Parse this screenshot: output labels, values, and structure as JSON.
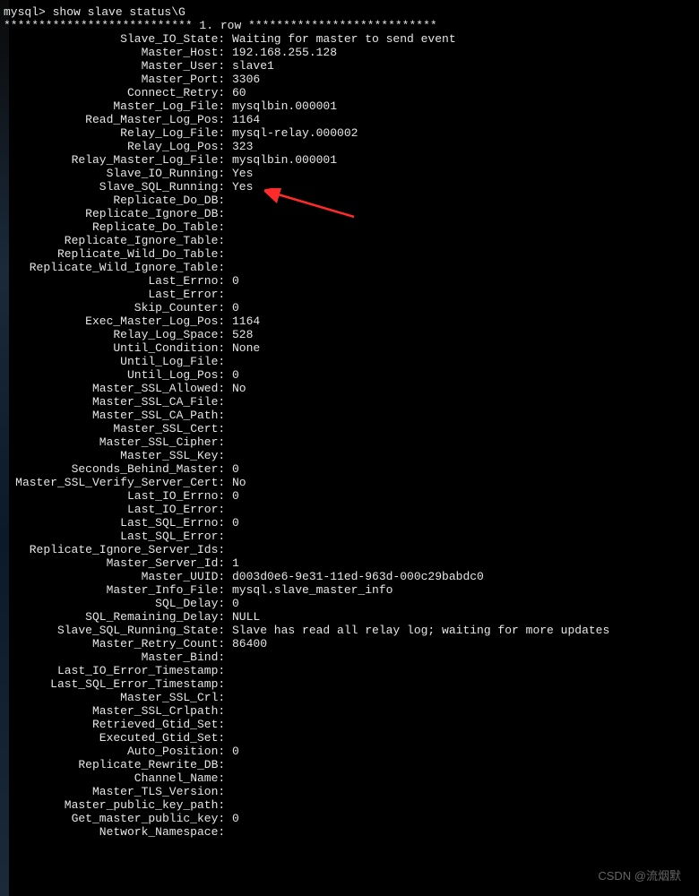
{
  "terminal": {
    "prompt": "mysql> ",
    "command": "show slave status\\G",
    "row_header": "*************************** 1. row ***************************",
    "fields": [
      {
        "label": "Slave_IO_State",
        "value": "Waiting for master to send event"
      },
      {
        "label": "Master_Host",
        "value": "192.168.255.128"
      },
      {
        "label": "Master_User",
        "value": "slave1"
      },
      {
        "label": "Master_Port",
        "value": "3306"
      },
      {
        "label": "Connect_Retry",
        "value": "60"
      },
      {
        "label": "Master_Log_File",
        "value": "mysqlbin.000001"
      },
      {
        "label": "Read_Master_Log_Pos",
        "value": "1164"
      },
      {
        "label": "Relay_Log_File",
        "value": "mysql-relay.000002"
      },
      {
        "label": "Relay_Log_Pos",
        "value": "323"
      },
      {
        "label": "Relay_Master_Log_File",
        "value": "mysqlbin.000001"
      },
      {
        "label": "Slave_IO_Running",
        "value": "Yes"
      },
      {
        "label": "Slave_SQL_Running",
        "value": "Yes"
      },
      {
        "label": "Replicate_Do_DB",
        "value": ""
      },
      {
        "label": "Replicate_Ignore_DB",
        "value": ""
      },
      {
        "label": "Replicate_Do_Table",
        "value": ""
      },
      {
        "label": "Replicate_Ignore_Table",
        "value": ""
      },
      {
        "label": "Replicate_Wild_Do_Table",
        "value": ""
      },
      {
        "label": "Replicate_Wild_Ignore_Table",
        "value": ""
      },
      {
        "label": "Last_Errno",
        "value": "0"
      },
      {
        "label": "Last_Error",
        "value": ""
      },
      {
        "label": "Skip_Counter",
        "value": "0"
      },
      {
        "label": "Exec_Master_Log_Pos",
        "value": "1164"
      },
      {
        "label": "Relay_Log_Space",
        "value": "528"
      },
      {
        "label": "Until_Condition",
        "value": "None"
      },
      {
        "label": "Until_Log_File",
        "value": ""
      },
      {
        "label": "Until_Log_Pos",
        "value": "0"
      },
      {
        "label": "Master_SSL_Allowed",
        "value": "No"
      },
      {
        "label": "Master_SSL_CA_File",
        "value": ""
      },
      {
        "label": "Master_SSL_CA_Path",
        "value": ""
      },
      {
        "label": "Master_SSL_Cert",
        "value": ""
      },
      {
        "label": "Master_SSL_Cipher",
        "value": ""
      },
      {
        "label": "Master_SSL_Key",
        "value": ""
      },
      {
        "label": "Seconds_Behind_Master",
        "value": "0"
      },
      {
        "label": "Master_SSL_Verify_Server_Cert",
        "value": "No"
      },
      {
        "label": "Last_IO_Errno",
        "value": "0"
      },
      {
        "label": "Last_IO_Error",
        "value": ""
      },
      {
        "label": "Last_SQL_Errno",
        "value": "0"
      },
      {
        "label": "Last_SQL_Error",
        "value": ""
      },
      {
        "label": "Replicate_Ignore_Server_Ids",
        "value": ""
      },
      {
        "label": "Master_Server_Id",
        "value": "1"
      },
      {
        "label": "Master_UUID",
        "value": "d003d0e6-9e31-11ed-963d-000c29babdc0"
      },
      {
        "label": "Master_Info_File",
        "value": "mysql.slave_master_info"
      },
      {
        "label": "SQL_Delay",
        "value": "0"
      },
      {
        "label": "SQL_Remaining_Delay",
        "value": "NULL"
      },
      {
        "label": "Slave_SQL_Running_State",
        "value": "Slave has read all relay log; waiting for more updates"
      },
      {
        "label": "Master_Retry_Count",
        "value": "86400"
      },
      {
        "label": "Master_Bind",
        "value": ""
      },
      {
        "label": "Last_IO_Error_Timestamp",
        "value": ""
      },
      {
        "label": "Last_SQL_Error_Timestamp",
        "value": ""
      },
      {
        "label": "Master_SSL_Crl",
        "value": ""
      },
      {
        "label": "Master_SSL_Crlpath",
        "value": ""
      },
      {
        "label": "Retrieved_Gtid_Set",
        "value": ""
      },
      {
        "label": "Executed_Gtid_Set",
        "value": ""
      },
      {
        "label": "Auto_Position",
        "value": "0"
      },
      {
        "label": "Replicate_Rewrite_DB",
        "value": ""
      },
      {
        "label": "Channel_Name",
        "value": ""
      },
      {
        "label": "Master_TLS_Version",
        "value": ""
      },
      {
        "label": "Master_public_key_path",
        "value": ""
      },
      {
        "label": "Get_master_public_key",
        "value": "0"
      },
      {
        "label": "Network_Namespace",
        "value": ""
      }
    ]
  },
  "annotation": {
    "arrow_color": "#ff2a2a"
  },
  "watermark": "CSDN @流烟默"
}
